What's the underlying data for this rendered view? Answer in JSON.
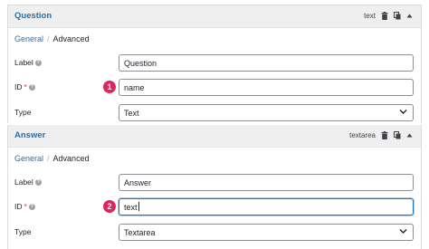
{
  "panels": [
    {
      "title": "Question",
      "type_tag": "text",
      "tabs": {
        "general": "General",
        "separator": "/",
        "advanced": "Advanced"
      },
      "fields": {
        "label": {
          "label": "Label",
          "value": "Question"
        },
        "id": {
          "label": "ID",
          "required_mark": "*",
          "value": "name",
          "badge": "1"
        },
        "type": {
          "label": "Type",
          "value": "Text"
        }
      }
    },
    {
      "title": "Answer",
      "type_tag": "textarea",
      "tabs": {
        "general": "General",
        "separator": "/",
        "advanced": "Advanced"
      },
      "fields": {
        "label": {
          "label": "Label",
          "value": "Answer"
        },
        "id": {
          "label": "ID",
          "required_mark": "*",
          "value": "text",
          "badge": "2"
        },
        "type": {
          "label": "Type",
          "value": "Textarea"
        }
      }
    }
  ],
  "icons": {
    "delete": "trash-icon",
    "duplicate": "duplicate-icon",
    "collapse": "caret-up-icon",
    "help": "help-icon",
    "select": "chevron-down-icon"
  },
  "colors": {
    "accent": "#2271b1",
    "badge": "#e0245e",
    "required": "#d63638",
    "header_bg": "#efeff0"
  }
}
